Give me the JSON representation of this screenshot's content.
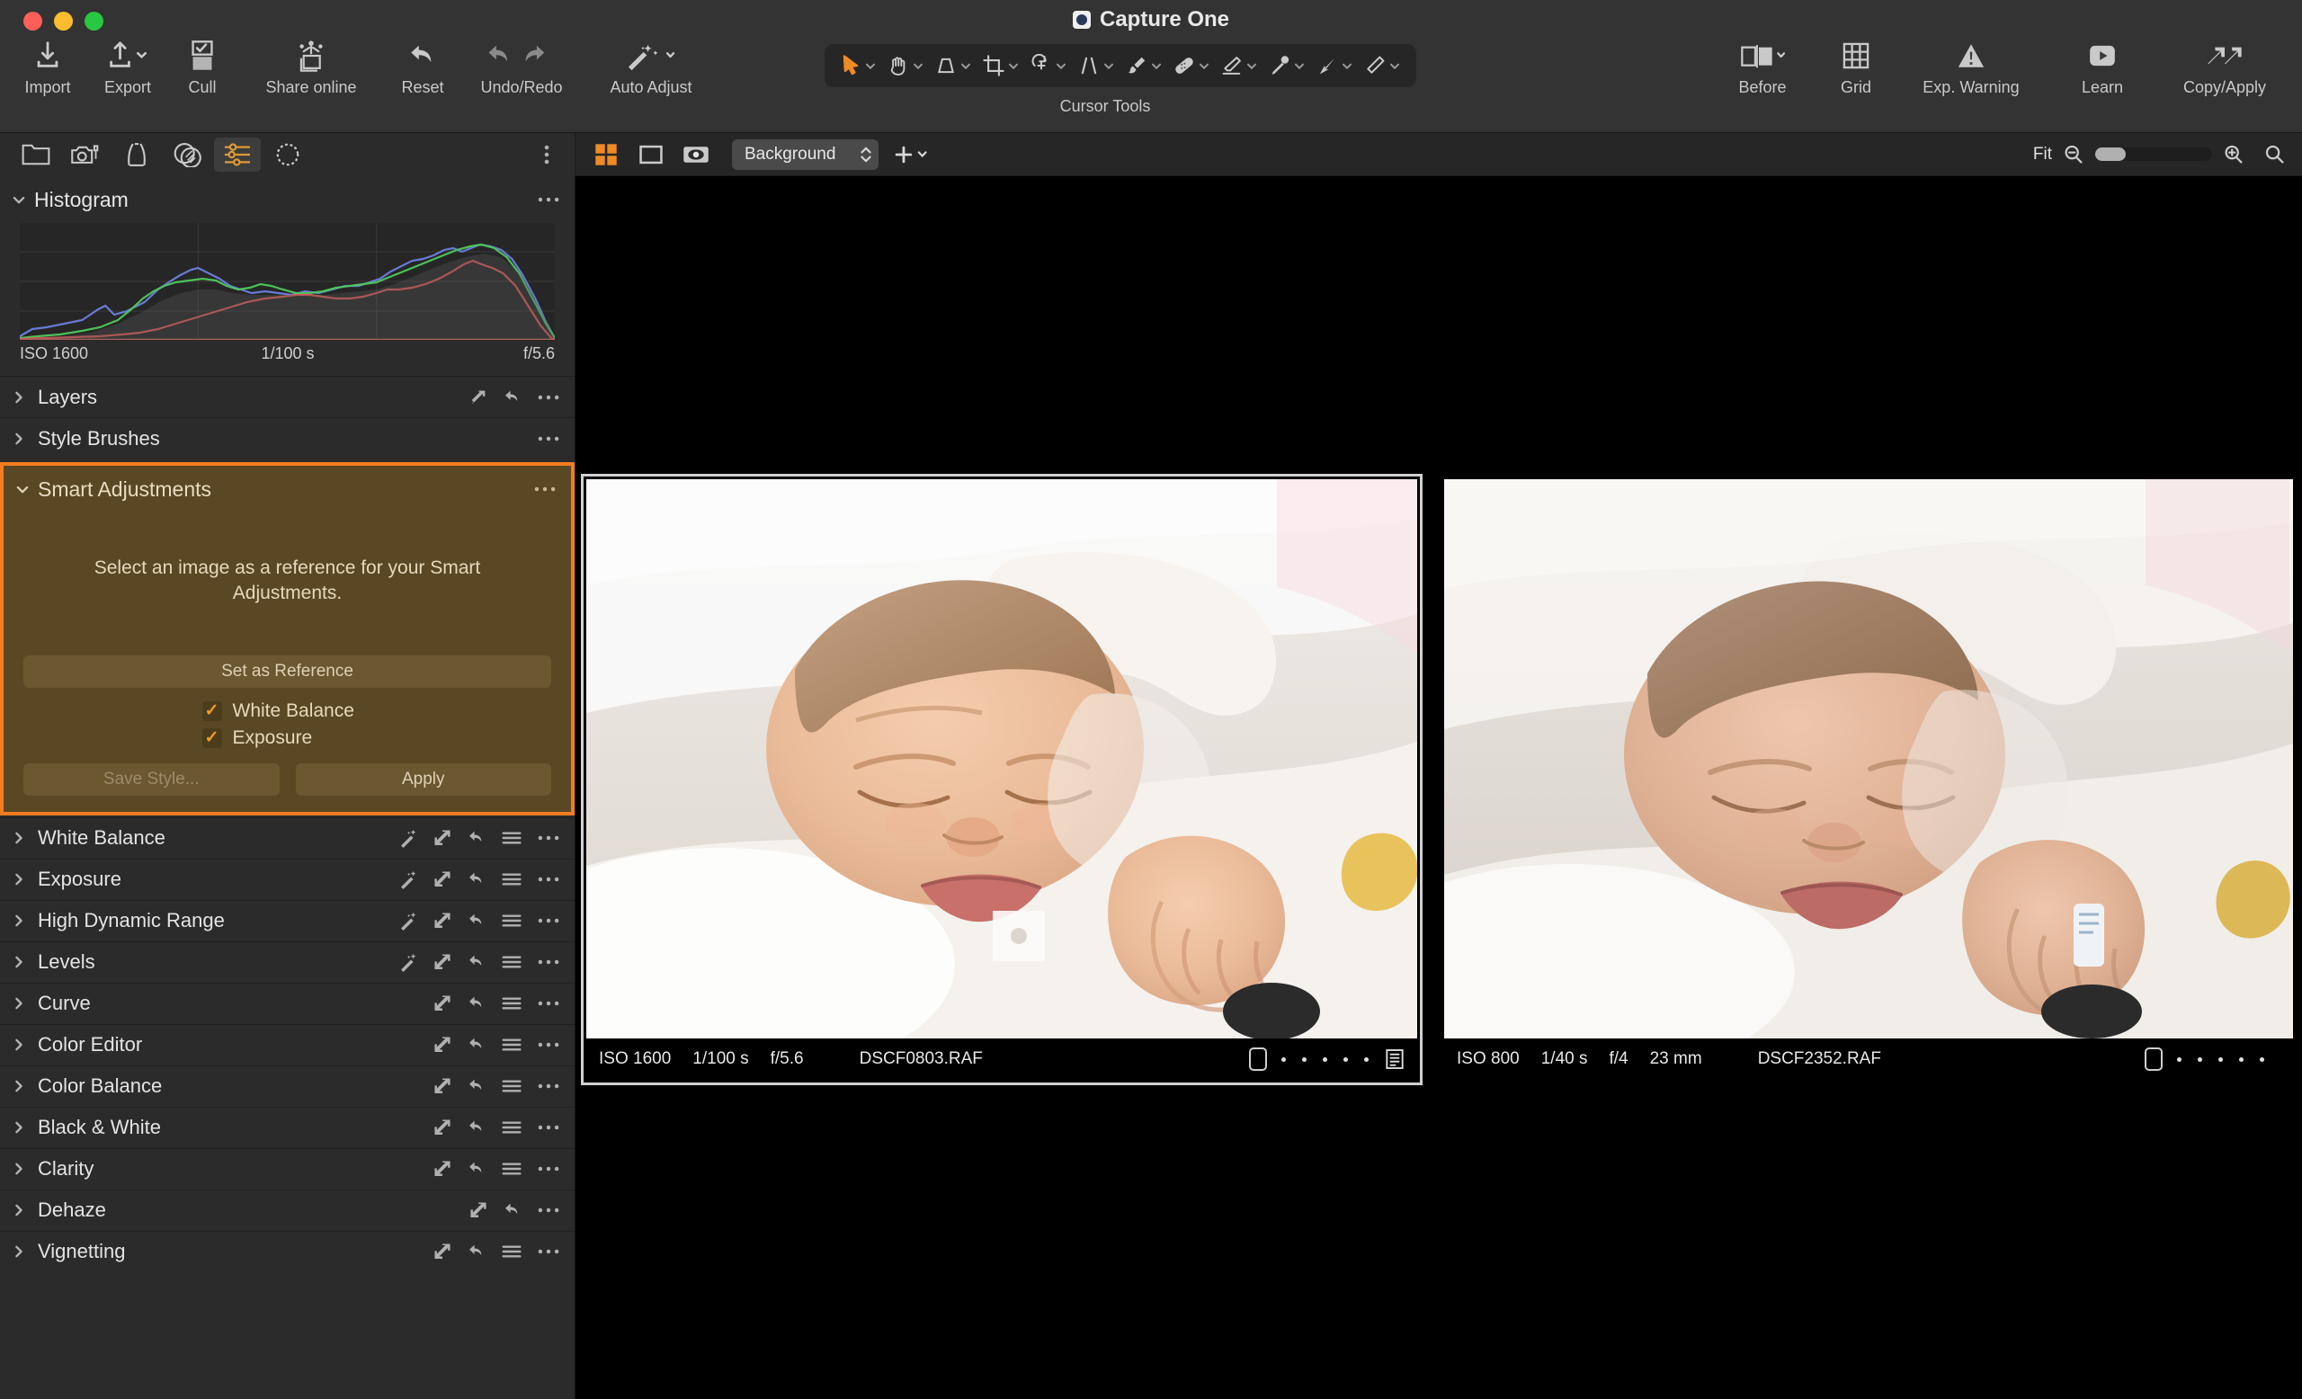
{
  "window": {
    "app_title": "Capture One",
    "logo_icon": "capture-one-logo"
  },
  "toolbar": {
    "left_items": [
      {
        "label": "Import",
        "icon": "import-icon",
        "has_chevron": false
      },
      {
        "label": "Export",
        "icon": "export-icon",
        "has_chevron": true
      },
      {
        "label": "Cull",
        "icon": "cull-icon",
        "has_chevron": false
      },
      {
        "label": "Share online",
        "icon": "share-online-icon",
        "has_chevron": false
      },
      {
        "label": "Reset",
        "icon": "reset-icon",
        "has_chevron": false
      },
      {
        "label": "Undo/Redo",
        "icon": "undo-redo-icon",
        "has_chevron": false
      },
      {
        "label": "Auto Adjust",
        "icon": "auto-adjust-wand-icon",
        "has_chevron": true
      }
    ],
    "cursor_tools": {
      "group_label": "Cursor Tools",
      "tools": [
        {
          "icon": "pointer-select-icon",
          "active": true
        },
        {
          "icon": "pan-hand-icon",
          "active": false
        },
        {
          "icon": "keystone-icon",
          "active": false
        },
        {
          "icon": "crop-icon",
          "active": false
        },
        {
          "icon": "rotate-icon",
          "active": false
        },
        {
          "icon": "straighten-icon",
          "active": false
        },
        {
          "icon": "spot-removal-brush-icon",
          "active": false
        },
        {
          "icon": "heal-bandage-icon",
          "active": false
        },
        {
          "icon": "eraser-icon",
          "active": false
        },
        {
          "icon": "color-picker-icon",
          "active": false
        },
        {
          "icon": "gradient-mask-icon",
          "active": false
        },
        {
          "icon": "draw-mask-pen-icon",
          "active": false
        }
      ]
    },
    "right_items": [
      {
        "label": "Before",
        "icon": "before-after-icon",
        "has_chevron": true
      },
      {
        "label": "Grid",
        "icon": "grid-icon",
        "has_chevron": false
      },
      {
        "label": "Exp. Warning",
        "icon": "exposure-warning-icon",
        "has_chevron": false
      },
      {
        "label": "Learn",
        "icon": "learn-play-icon",
        "has_chevron": false
      },
      {
        "label": "Copy/Apply",
        "icon": "copy-apply-arrows-icon",
        "has_chevron": false
      }
    ]
  },
  "tool_tabs": [
    {
      "name": "library",
      "icon": "folder-icon",
      "active": false
    },
    {
      "name": "capture",
      "icon": "tethered-camera-icon",
      "active": false
    },
    {
      "name": "lens",
      "icon": "lens-correction-icon",
      "active": false
    },
    {
      "name": "color",
      "icon": "color-wheel-icon",
      "active": false
    },
    {
      "name": "exposure",
      "icon": "sliders-icon",
      "active": true
    },
    {
      "name": "details",
      "icon": "dotted-circle-icon",
      "active": false
    }
  ],
  "viewer_bar": {
    "grid_view_icon": "grid-view-icon",
    "single_view_icon": "single-view-icon",
    "proof_view_icon": "proof-eye-icon",
    "background_select": {
      "value": "Background",
      "stepper_icon": "stepper-updown-icon"
    },
    "add_icon": "plus-icon",
    "add_chevron_icon": "chevron-down-icon",
    "zoom": {
      "fit_label": "Fit",
      "zoom_out_icon": "zoom-out-icon",
      "zoom_in_icon": "zoom-in-icon",
      "slider_value": 8
    },
    "search_icon": "search-icon"
  },
  "histogram": {
    "title": "Histogram",
    "menu_icon": "ellipsis-icon",
    "iso": "ISO 1600",
    "shutter": "1/100 s",
    "aperture": "f/5.6"
  },
  "panels": [
    {
      "title": "Layers",
      "icons": [
        "copy-icon",
        "reset-icon",
        "ellipsis-icon"
      ]
    },
    {
      "title": "Style Brushes",
      "icons": [
        "ellipsis-icon"
      ]
    }
  ],
  "smart_adjustments": {
    "title": "Smart Adjustments",
    "menu_icon": "ellipsis-icon",
    "hint_text": "Select an image as a reference for your Smart Adjustments.",
    "set_reference_label": "Set as Reference",
    "checkboxes": [
      {
        "label": "White Balance",
        "checked": true
      },
      {
        "label": "Exposure",
        "checked": true
      }
    ],
    "save_style_label": "Save Style...",
    "save_style_disabled": true,
    "apply_label": "Apply",
    "accent_color": "#f57c20",
    "panel_background": "#5a4824"
  },
  "tool_list": [
    {
      "title": "White Balance",
      "icons": [
        "wand-icon",
        "copy-icon",
        "reset-icon",
        "menu-icon",
        "ellipsis-icon"
      ]
    },
    {
      "title": "Exposure",
      "icons": [
        "wand-icon",
        "copy-icon",
        "reset-icon",
        "menu-icon",
        "ellipsis-icon"
      ]
    },
    {
      "title": "High Dynamic Range",
      "icons": [
        "wand-icon",
        "copy-icon",
        "reset-icon",
        "menu-icon",
        "ellipsis-icon"
      ]
    },
    {
      "title": "Levels",
      "icons": [
        "wand-icon",
        "copy-icon",
        "reset-icon",
        "menu-icon",
        "ellipsis-icon"
      ]
    },
    {
      "title": "Curve",
      "icons": [
        "copy-icon",
        "reset-icon",
        "menu-icon",
        "ellipsis-icon"
      ]
    },
    {
      "title": "Color Editor",
      "icons": [
        "copy-icon",
        "reset-icon",
        "menu-icon",
        "ellipsis-icon"
      ]
    },
    {
      "title": "Color Balance",
      "icons": [
        "copy-icon",
        "reset-icon",
        "menu-icon",
        "ellipsis-icon"
      ]
    },
    {
      "title": "Black & White",
      "icons": [
        "copy-icon",
        "reset-icon",
        "menu-icon",
        "ellipsis-icon"
      ]
    },
    {
      "title": "Clarity",
      "icons": [
        "copy-icon",
        "reset-icon",
        "menu-icon",
        "ellipsis-icon"
      ]
    },
    {
      "title": "Dehaze",
      "icons": [
        "copy-icon",
        "reset-icon",
        "ellipsis-icon"
      ]
    },
    {
      "title": "Vignetting",
      "icons": [
        "copy-icon",
        "reset-icon",
        "menu-icon",
        "ellipsis-icon"
      ]
    }
  ],
  "images": [
    {
      "selected": true,
      "iso": "ISO 1600",
      "shutter": "1/100 s",
      "aperture": "f/5.6",
      "focal": "",
      "filename": "DSCF0803.RAF",
      "rating_dots": 5,
      "has_list_icon": true
    },
    {
      "selected": false,
      "iso": "ISO 800",
      "shutter": "1/40 s",
      "aperture": "f/4",
      "focal": "23 mm",
      "filename": "DSCF2352.RAF",
      "rating_dots": 5,
      "has_list_icon": false
    }
  ]
}
